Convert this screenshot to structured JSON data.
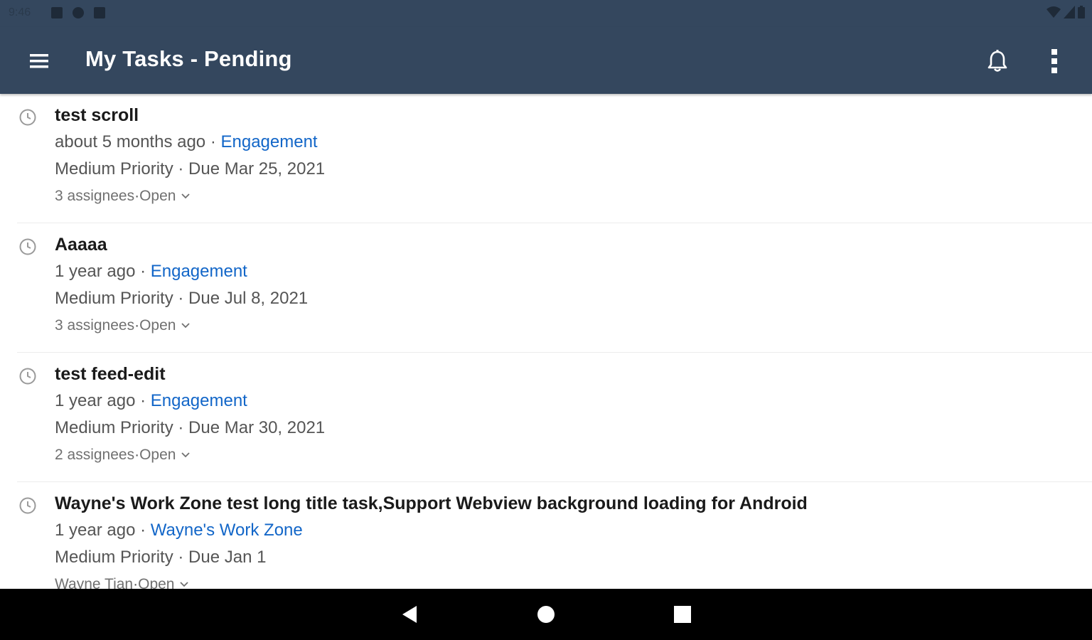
{
  "status_bar": {
    "time": "9:46"
  },
  "app_bar": {
    "title": "My Tasks - Pending",
    "icons": [
      "menu-icon",
      "bell-icon",
      "more-vert-icon"
    ]
  },
  "tasks": [
    {
      "title": "test scroll",
      "age": "about 5 months ago",
      "workspace": "Engagement",
      "priority": "Medium Priority",
      "due": "Due Mar 25, 2021",
      "assignees": "3 assignees",
      "status": "Open"
    },
    {
      "title": "Aaaaa",
      "age": "1 year ago",
      "workspace": "Engagement",
      "priority": "Medium Priority",
      "due": "Due Jul 8, 2021",
      "assignees": "3 assignees",
      "status": "Open"
    },
    {
      "title": "test feed-edit",
      "age": "1 year ago",
      "workspace": "Engagement",
      "priority": "Medium Priority",
      "due": "Due Mar 30, 2021",
      "assignees": "2 assignees",
      "status": "Open"
    },
    {
      "title": "Wayne's Work Zone test long title task,Support Webview background loading for Android",
      "age": "1 year ago",
      "workspace": "Wayne's Work Zone",
      "priority": "Medium Priority",
      "due": "Due Jan 1",
      "assignees": "Wayne Tian",
      "status": "Open"
    }
  ],
  "separator": " · ",
  "colors": {
    "app_bar": "#34475e",
    "link": "#1266c8",
    "nav_bar": "#000000"
  }
}
